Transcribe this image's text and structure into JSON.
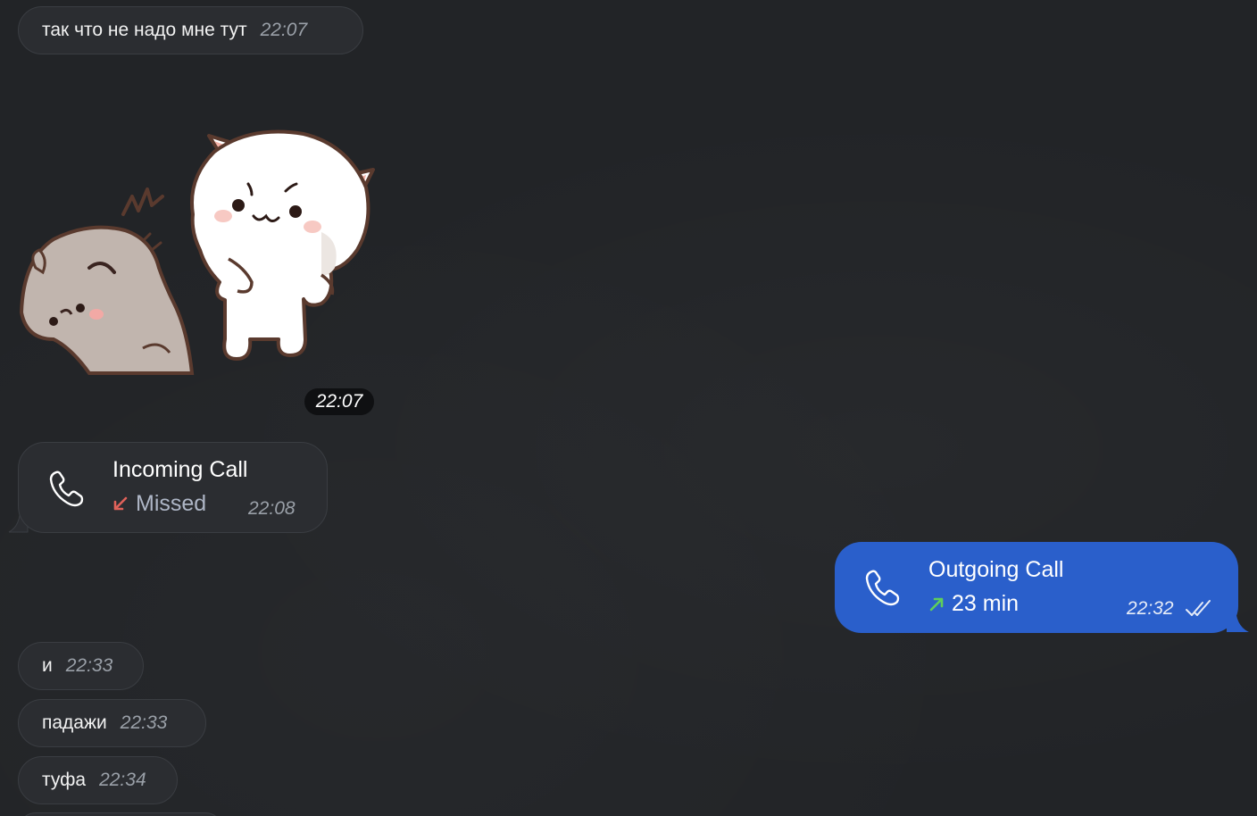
{
  "messages": [
    {
      "text": "так что не надо мне тут",
      "time": "22:07"
    },
    {
      "text": "и",
      "time": "22:33"
    },
    {
      "text": "падажи",
      "time": "22:33"
    },
    {
      "text": "туфа",
      "time": "22:34"
    }
  ],
  "sticker": {
    "time": "22:07"
  },
  "incoming_call": {
    "title": "Incoming Call",
    "status": "Missed",
    "time": "22:08",
    "status_color": "#e0625a"
  },
  "outgoing_call": {
    "title": "Outgoing Call",
    "duration": "23 min",
    "time": "22:32",
    "bubble_color": "#2a5fcb",
    "arrow_color": "#5fce5b"
  },
  "colors": {
    "background": "#222427",
    "incoming_bubble": "#2b2d31",
    "text_time": "#9aa0a8"
  },
  "icons": {
    "call": "phone-icon",
    "missed": "arrow-down-left-icon",
    "outgoing": "arrow-up-right-icon",
    "read": "double-check-icon"
  }
}
